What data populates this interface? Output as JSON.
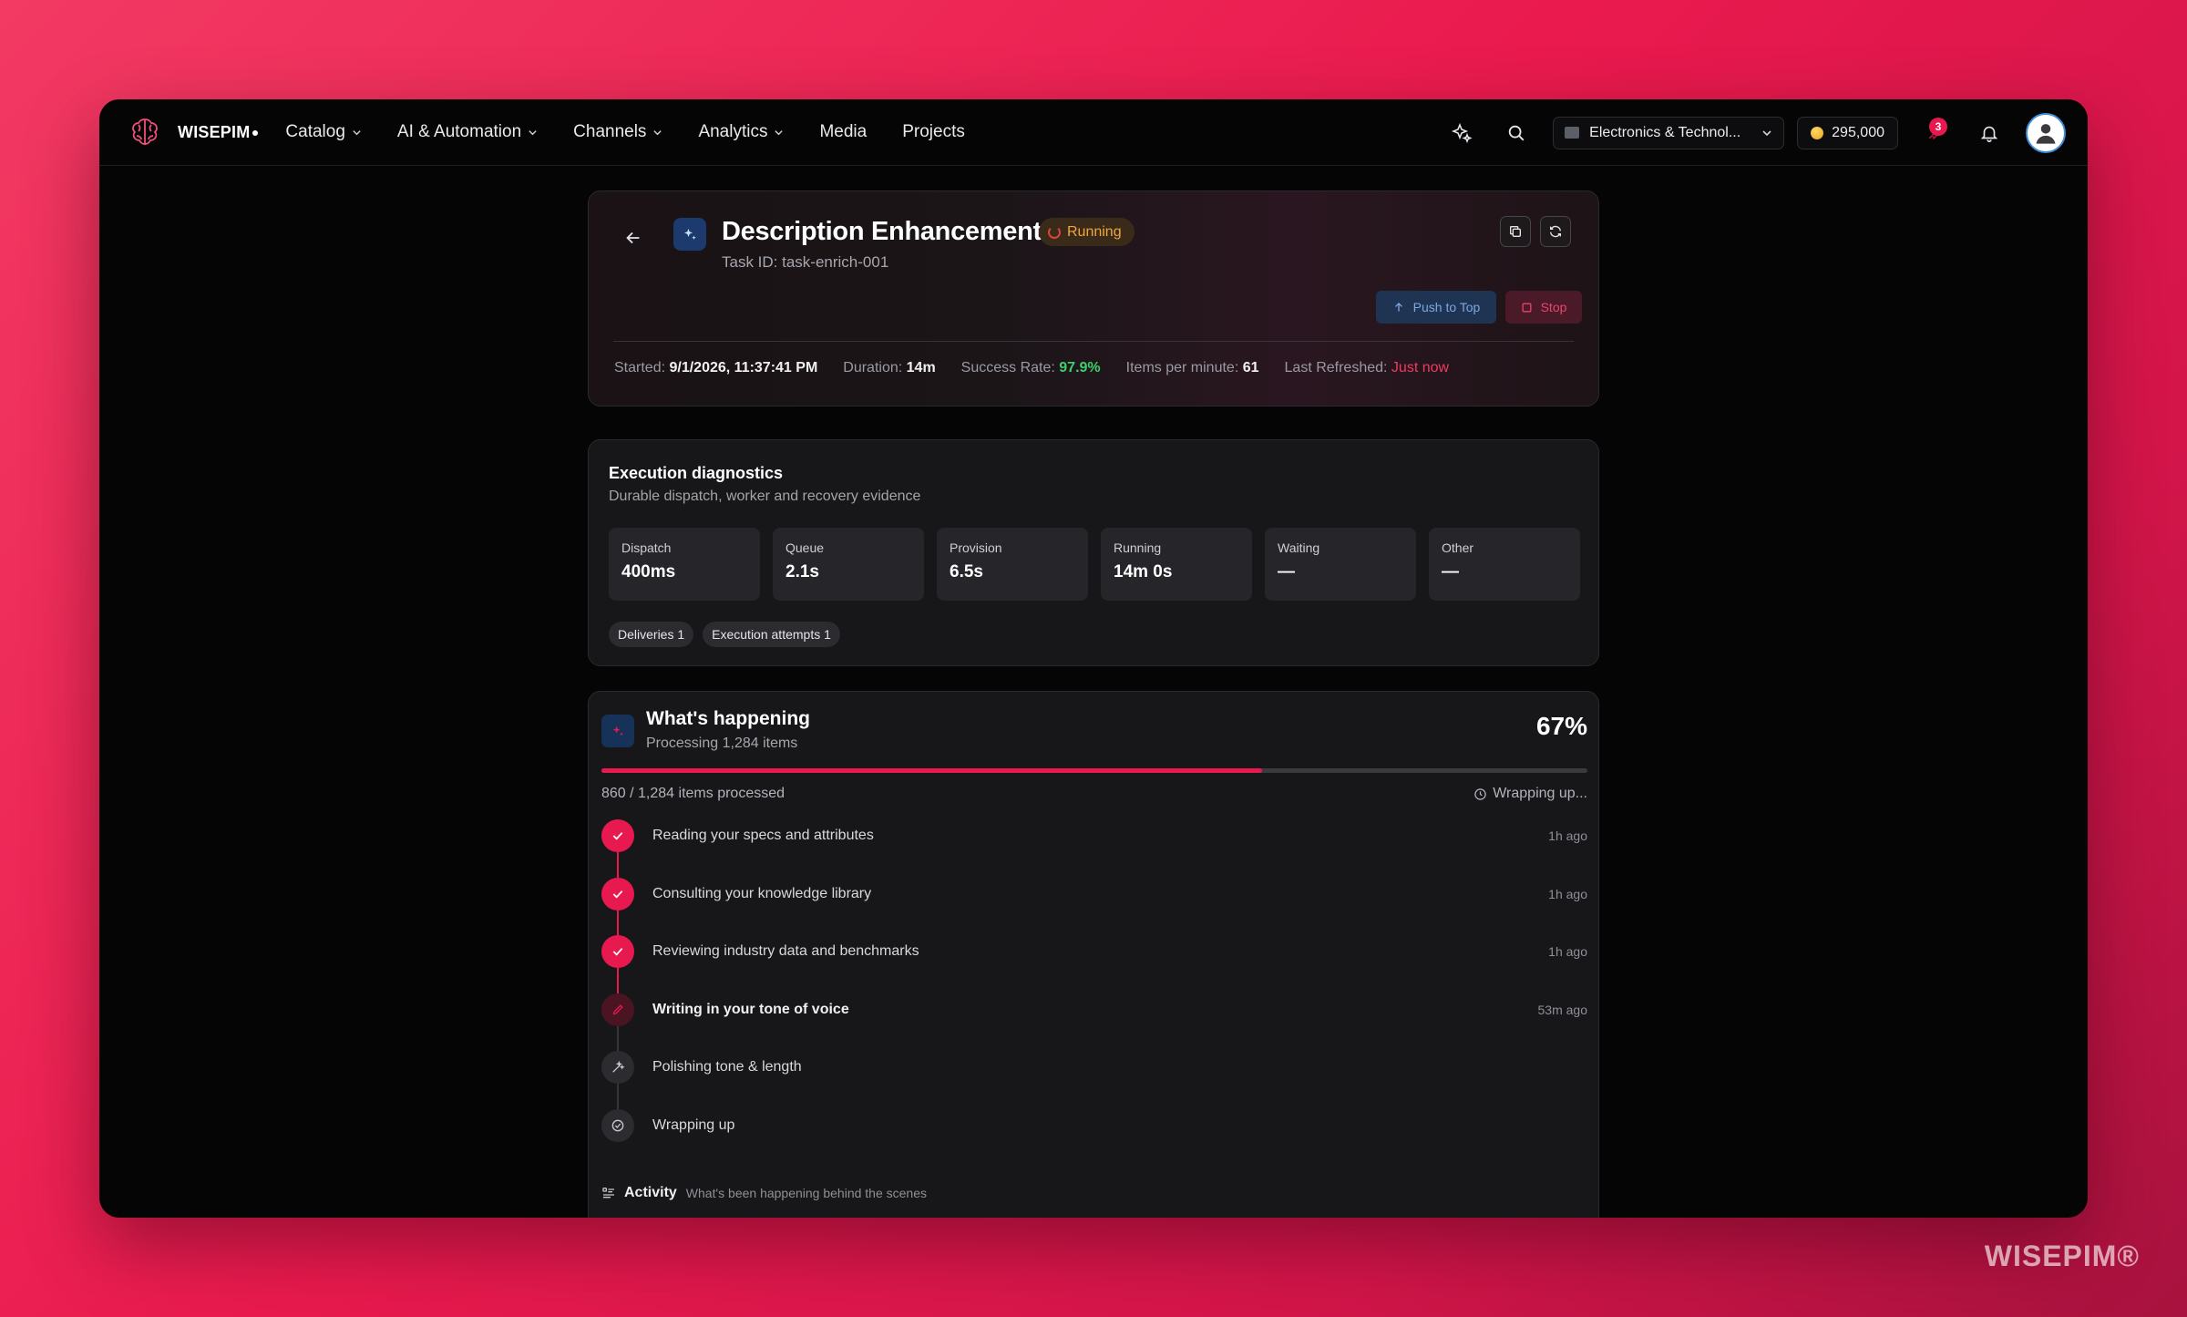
{
  "nav": {
    "brand": "WISEPIM",
    "menu": [
      {
        "label": "Catalog",
        "dropdown": true
      },
      {
        "label": "AI & Automation",
        "dropdown": true
      },
      {
        "label": "Channels",
        "dropdown": true
      },
      {
        "label": "Analytics",
        "dropdown": true
      },
      {
        "label": "Media",
        "dropdown": false
      },
      {
        "label": "Projects",
        "dropdown": false
      }
    ],
    "workspace": "Electronics & Technol...",
    "credits": "295,000",
    "notification_count": "3"
  },
  "task": {
    "title": "Description Enhancement",
    "status": "Running",
    "task_id": "Task ID: task-enrich-001",
    "push_label": "Push to Top",
    "stop_label": "Stop",
    "stats": {
      "started_label": "Started:",
      "started_value": "9/1/2026, 11:37:41 PM",
      "duration_label": "Duration:",
      "duration_value": "14m",
      "success_label": "Success Rate:",
      "success_value": "97.9%",
      "ipm_label": "Items per minute:",
      "ipm_value": "61",
      "refreshed_label": "Last Refreshed:",
      "refreshed_value": "Just now"
    }
  },
  "diagnostics": {
    "title": "Execution diagnostics",
    "subtitle": "Durable dispatch, worker and recovery evidence",
    "metrics": [
      {
        "label": "Dispatch",
        "value": "400ms"
      },
      {
        "label": "Queue",
        "value": "2.1s"
      },
      {
        "label": "Provision",
        "value": "6.5s"
      },
      {
        "label": "Running",
        "value": "14m 0s"
      },
      {
        "label": "Waiting",
        "value": "—"
      },
      {
        "label": "Other",
        "value": "—"
      }
    ],
    "chips": [
      "Deliveries 1",
      "Execution attempts 1"
    ]
  },
  "happening": {
    "title": "What's happening",
    "subtitle": "Processing 1,284 items",
    "percent": "67%",
    "progress": 0.67,
    "processed_text": "860 / 1,284 items processed",
    "status_text": "Wrapping up...",
    "steps": [
      {
        "label": "Reading your specs and attributes",
        "time": "1h ago",
        "state": "done"
      },
      {
        "label": "Consulting your knowledge library",
        "time": "1h ago",
        "state": "done"
      },
      {
        "label": "Reviewing industry data and benchmarks",
        "time": "1h ago",
        "state": "done"
      },
      {
        "label": "Writing in your tone of voice",
        "time": "53m ago",
        "state": "active"
      },
      {
        "label": "Polishing tone & length",
        "time": "",
        "state": "pending"
      },
      {
        "label": "Wrapping up",
        "time": "",
        "state": "pending"
      }
    ],
    "activity_title": "Activity",
    "activity_sub": "What's been happening behind the scenes"
  },
  "watermark": "WISEPIM®",
  "colors": {
    "accent": "#e8194f",
    "success": "#3ecf6a",
    "warning": "#f0a63a",
    "background_gradient_start": "#f23a63",
    "window": "#050505"
  }
}
